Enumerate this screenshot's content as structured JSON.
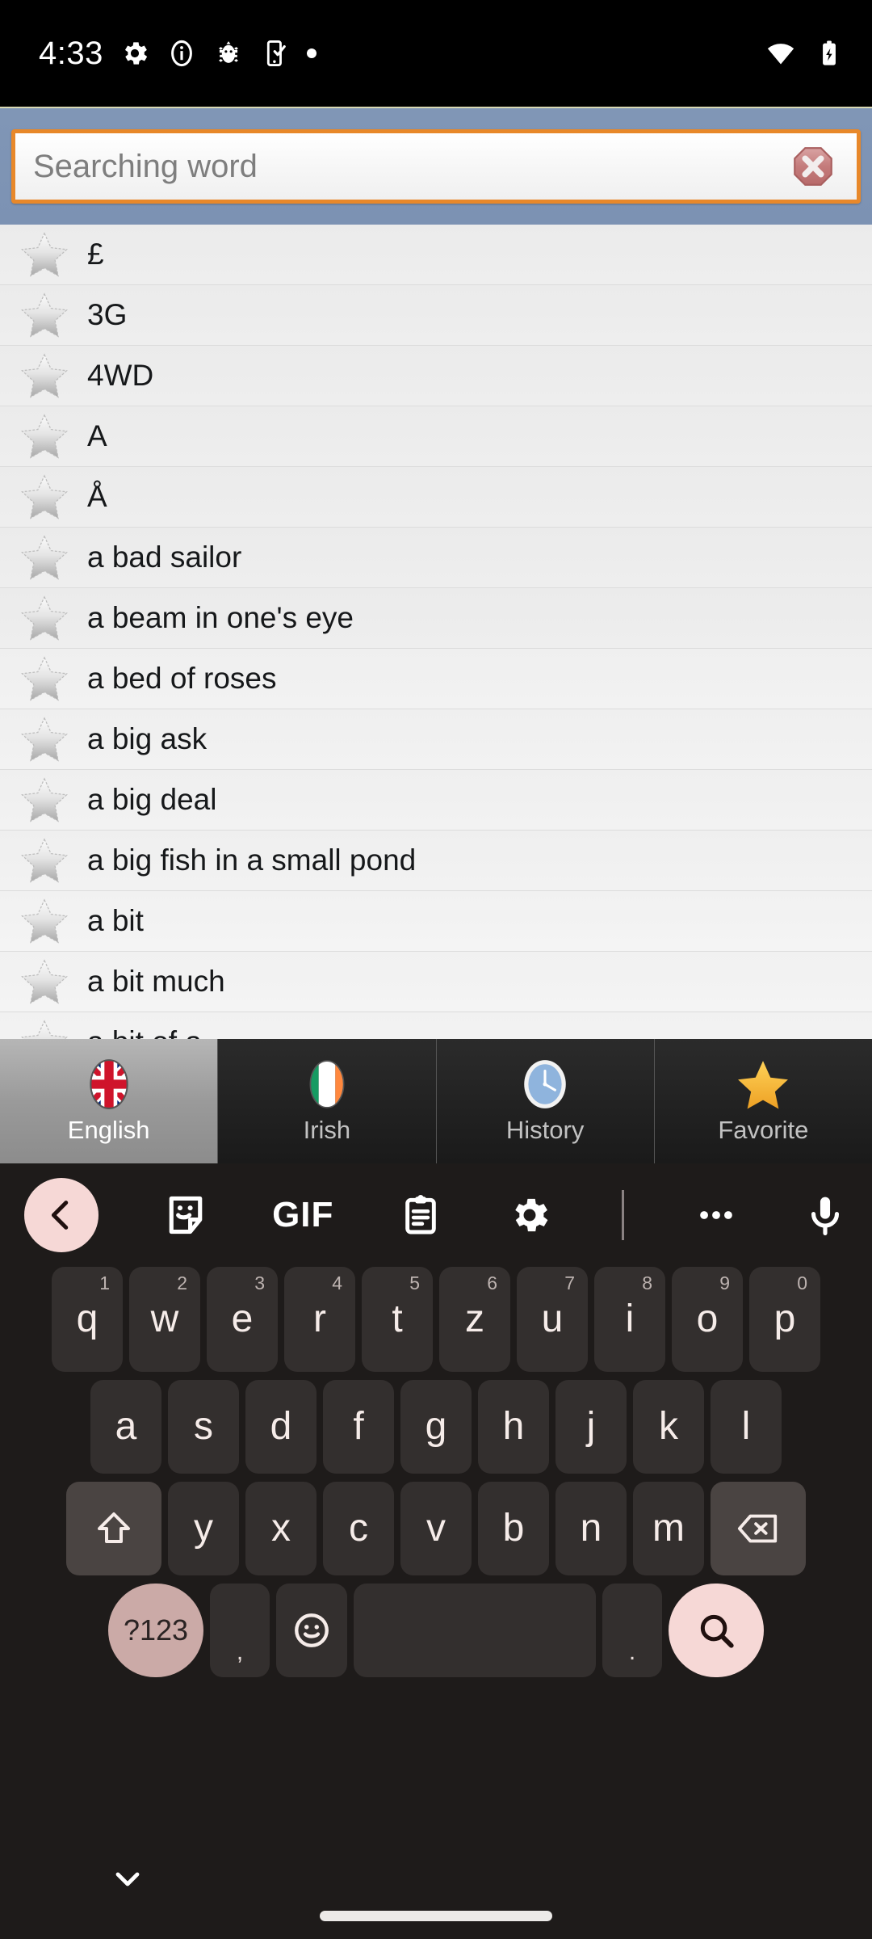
{
  "status_bar": {
    "time": "4:33",
    "left_icons": [
      "gear-icon",
      "info-icon",
      "bug-icon",
      "phone-check-icon",
      "dot-icon"
    ],
    "right_icons": [
      "wifi-icon",
      "battery-charging-icon"
    ]
  },
  "search": {
    "placeholder": "Searching word",
    "value": "",
    "clear_icon": "clear-octagon-icon",
    "accent_border": "#e8882a",
    "bar_background": "#7c92b3"
  },
  "word_list": {
    "items": [
      {
        "word": "£",
        "favorite_icon": "star-outline-icon"
      },
      {
        "word": "3G",
        "favorite_icon": "star-outline-icon"
      },
      {
        "word": "4WD",
        "favorite_icon": "star-outline-icon"
      },
      {
        "word": "A",
        "favorite_icon": "star-outline-icon"
      },
      {
        "word": "Å",
        "favorite_icon": "star-outline-icon"
      },
      {
        "word": "a bad sailor",
        "favorite_icon": "star-outline-icon"
      },
      {
        "word": "a beam in one's eye",
        "favorite_icon": "star-outline-icon"
      },
      {
        "word": "a bed of roses",
        "favorite_icon": "star-outline-icon"
      },
      {
        "word": "a big ask",
        "favorite_icon": "star-outline-icon"
      },
      {
        "word": "a big deal",
        "favorite_icon": "star-outline-icon"
      },
      {
        "word": "a big fish in a small pond",
        "favorite_icon": "star-outline-icon"
      },
      {
        "word": "a bit",
        "favorite_icon": "star-outline-icon"
      },
      {
        "word": "a bit much",
        "favorite_icon": "star-outline-icon"
      },
      {
        "word": "a bit of a",
        "favorite_icon": "star-outline-icon"
      }
    ]
  },
  "tabs": {
    "active": "English",
    "items": [
      {
        "label": "English",
        "icon": "uk-flag-icon",
        "selected": true
      },
      {
        "label": "Irish",
        "icon": "ireland-flag-icon",
        "selected": false
      },
      {
        "label": "History",
        "icon": "clock-icon",
        "selected": false
      },
      {
        "label": "Favorite",
        "icon": "star-filled-icon",
        "selected": false
      }
    ]
  },
  "keyboard": {
    "toolbar": [
      {
        "name": "back-button",
        "icon": "chevron-left-icon"
      },
      {
        "name": "sticker-button",
        "icon": "sticker-icon"
      },
      {
        "name": "gif-button",
        "icon": "gif-icon",
        "label": "GIF"
      },
      {
        "name": "clipboard-button",
        "icon": "clipboard-icon"
      },
      {
        "name": "settings-button",
        "icon": "gear-icon"
      },
      {
        "name": "more-button",
        "icon": "overflow-dots-icon"
      },
      {
        "name": "voice-input-button",
        "icon": "microphone-icon"
      }
    ],
    "layout": "QWERTZ",
    "row1": [
      {
        "key": "q",
        "sup": "1"
      },
      {
        "key": "w",
        "sup": "2"
      },
      {
        "key": "e",
        "sup": "3"
      },
      {
        "key": "r",
        "sup": "4"
      },
      {
        "key": "t",
        "sup": "5"
      },
      {
        "key": "z",
        "sup": "6"
      },
      {
        "key": "u",
        "sup": "7"
      },
      {
        "key": "i",
        "sup": "8"
      },
      {
        "key": "o",
        "sup": "9"
      },
      {
        "key": "p",
        "sup": "0"
      }
    ],
    "row2": [
      {
        "key": "a"
      },
      {
        "key": "s"
      },
      {
        "key": "d"
      },
      {
        "key": "f"
      },
      {
        "key": "g"
      },
      {
        "key": "h"
      },
      {
        "key": "j"
      },
      {
        "key": "k"
      },
      {
        "key": "l"
      }
    ],
    "row3": [
      {
        "key": "y"
      },
      {
        "key": "x"
      },
      {
        "key": "c"
      },
      {
        "key": "v"
      },
      {
        "key": "b"
      },
      {
        "key": "n"
      },
      {
        "key": "m"
      }
    ],
    "shift_icon": "shift-arrow-icon",
    "backspace_icon": "backspace-icon",
    "row4": {
      "symbols_label": "?123",
      "comma_label": ",",
      "emoji_icon": "emoji-smiley-icon",
      "space_label": "",
      "period_label": ".",
      "enter_icon": "search-magnifier-icon"
    }
  },
  "nav_bar": {
    "hide_keyboard_icon": "chevron-down-icon",
    "home_indicator": "home-pill"
  }
}
